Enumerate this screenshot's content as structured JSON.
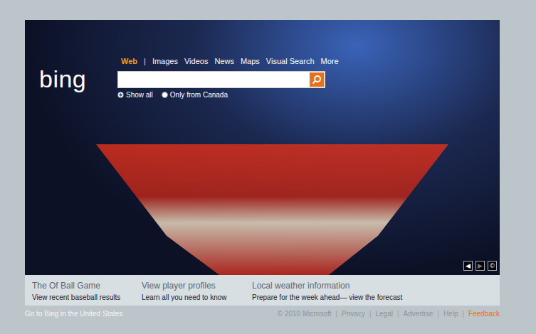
{
  "logo": {
    "text": "bing"
  },
  "nav": {
    "separator": "|",
    "items": [
      {
        "label": "Web",
        "selected": true
      },
      {
        "label": "Images",
        "selected": false
      },
      {
        "label": "Videos",
        "selected": false
      },
      {
        "label": "News",
        "selected": false
      },
      {
        "label": "Maps",
        "selected": false
      },
      {
        "label": "Visual Search",
        "selected": false
      },
      {
        "label": "More",
        "selected": false
      }
    ]
  },
  "search": {
    "value": ""
  },
  "scope": [
    {
      "label": "Show all",
      "selected": true
    },
    {
      "label": "Only from Canada",
      "selected": false
    }
  ],
  "photo_controls": [
    {
      "label": "◀",
      "disabled": false
    },
    {
      "label": "▶",
      "disabled": true
    },
    {
      "label": "©",
      "disabled": false
    }
  ],
  "highlights": [
    {
      "title": "The Of Ball Game",
      "subtitle": "View recent baseball results"
    },
    {
      "title": "View player profiles",
      "subtitle": "Learn all you need to know"
    },
    {
      "title": "Local weather information",
      "subtitle": "Prepare for the week ahead— view the forecast"
    }
  ],
  "footer": {
    "left": "Go to Bing in the United States",
    "separator": "|",
    "links": [
      {
        "label": "© 2010 Microsoft",
        "highlighted": false
      },
      {
        "label": "Privacy",
        "highlighted": false
      },
      {
        "label": "Legal",
        "highlighted": false
      },
      {
        "label": "Advertise",
        "highlighted": false
      },
      {
        "label": "Help",
        "highlighted": false
      },
      {
        "label": "Feedback",
        "highlighted": true
      }
    ]
  }
}
